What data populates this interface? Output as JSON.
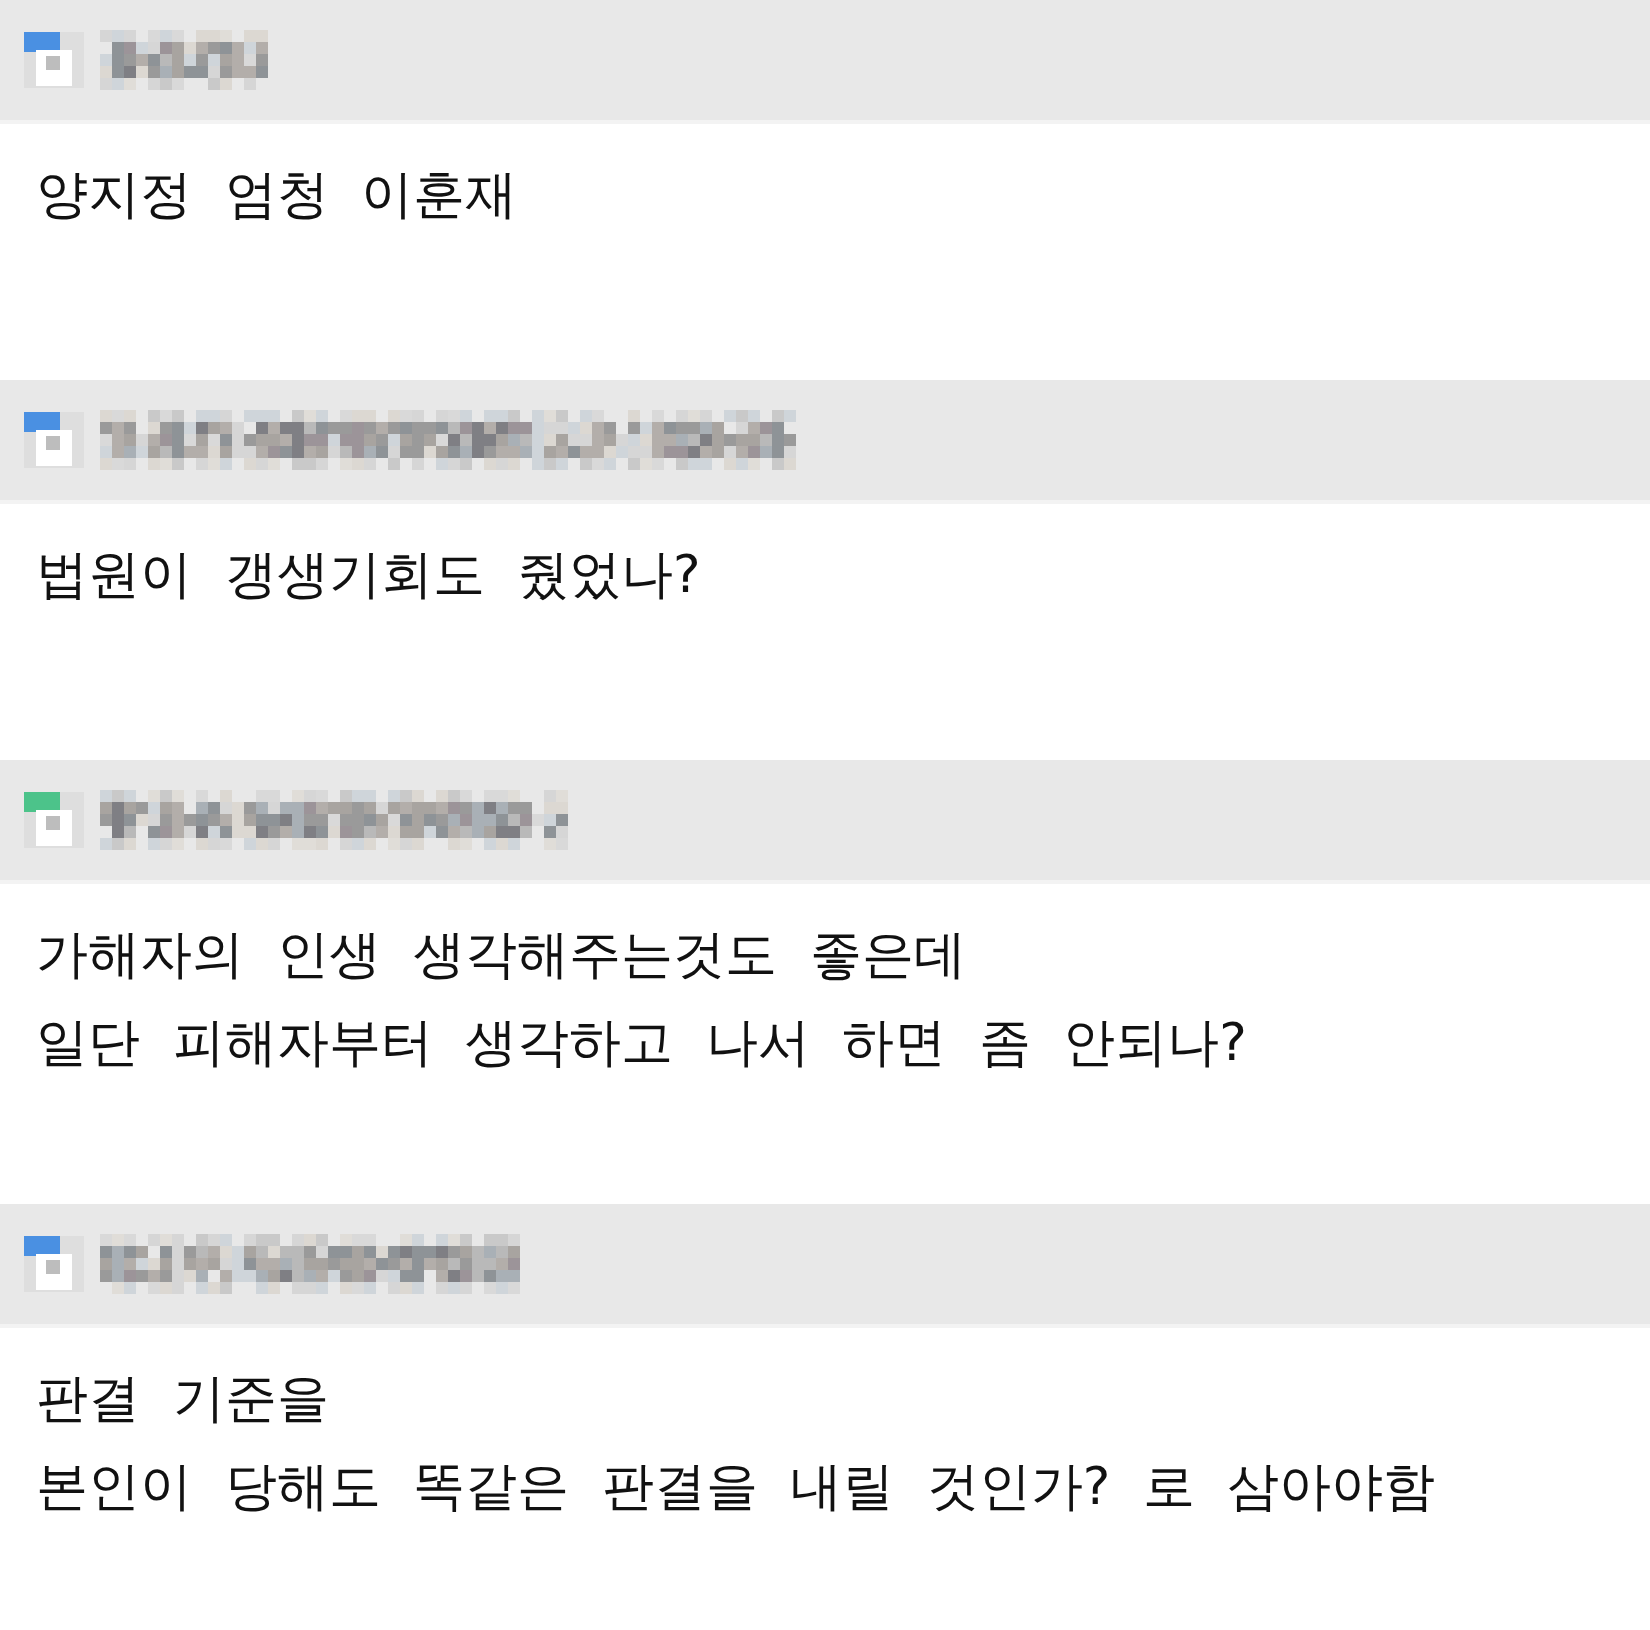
{
  "comments": [
    {
      "color": "#4a90e2",
      "text": "양지정 엄청 이훈재"
    },
    {
      "color": "#4a90e2",
      "text": "법원이 갱생기회도 줬었나?"
    },
    {
      "color": "#4cc38a",
      "text": "가해자의 인생 생각해주는것도 좋은데\n일단 피해자부터 생각하고 나서 하면 좀 안되나?"
    },
    {
      "color": "#4a90e2",
      "text": "판결 기준을\n본인이 당해도 똑같은 판결을 내릴 것인가? 로 삼아야함"
    }
  ]
}
